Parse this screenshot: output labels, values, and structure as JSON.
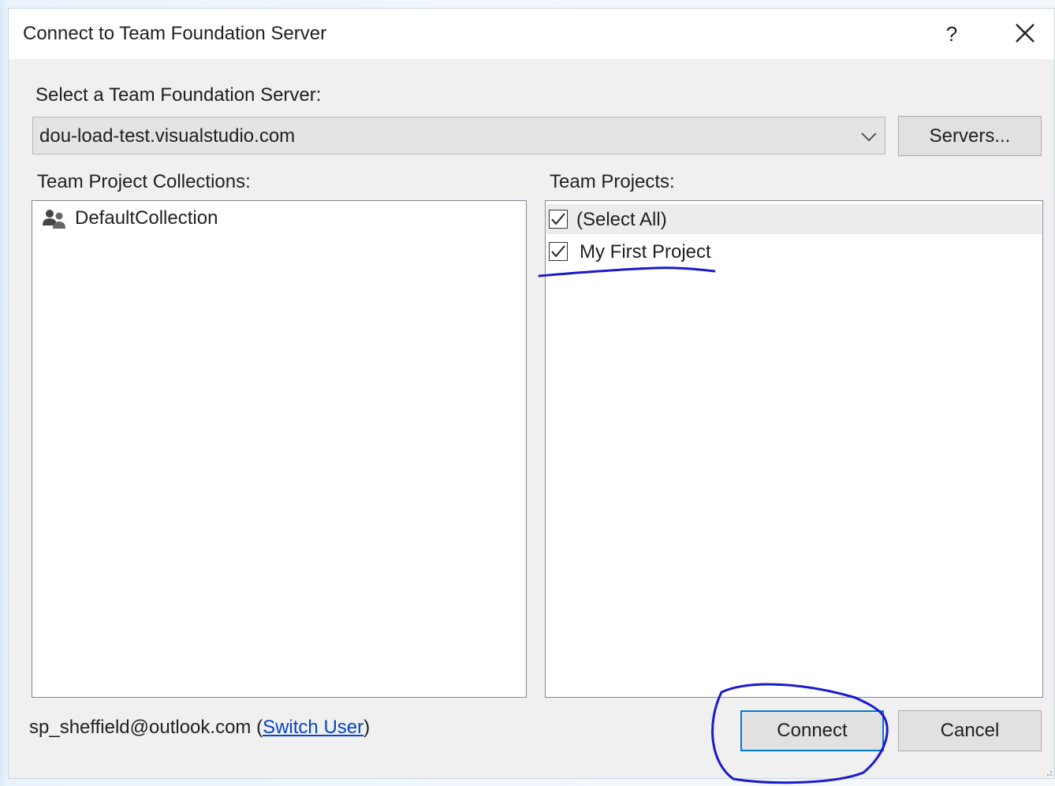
{
  "window": {
    "title": "Connect to Team Foundation Server",
    "help_label": "?"
  },
  "server": {
    "label": "Select a Team Foundation Server:",
    "selected": "dou-load-test.visualstudio.com",
    "servers_button": "Servers..."
  },
  "collections": {
    "label": "Team Project Collections:",
    "items": [
      {
        "label": "DefaultCollection",
        "icon": "users-group-icon"
      }
    ]
  },
  "projects": {
    "label": "Team Projects:",
    "items": [
      {
        "label": "(Select All)",
        "checked": true
      },
      {
        "label": "My First Project",
        "checked": true
      }
    ]
  },
  "footer": {
    "user_email": "sp_sheffield@outlook.com",
    "open_paren": " (",
    "switch_user": "Switch User",
    "close_paren": ")",
    "connect": "Connect",
    "cancel": "Cancel"
  },
  "colors": {
    "annotation": "#1a1acc",
    "focus_border": "#0078d7",
    "link": "#0645c8"
  }
}
